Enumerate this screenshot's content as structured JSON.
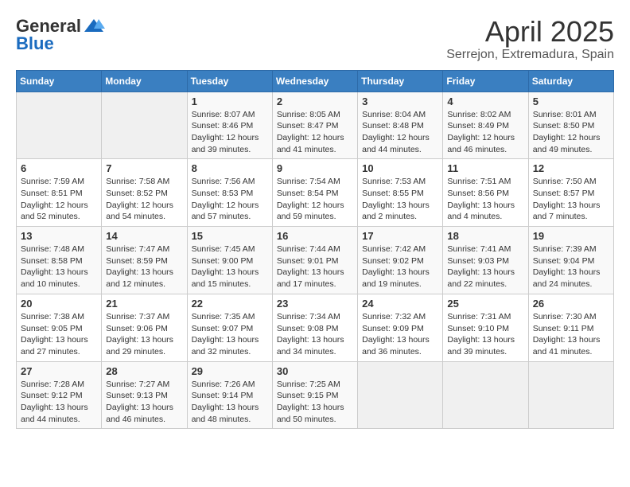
{
  "header": {
    "logo_general": "General",
    "logo_blue": "Blue",
    "title": "April 2025",
    "subtitle": "Serrejon, Extremadura, Spain"
  },
  "days_of_week": [
    "Sunday",
    "Monday",
    "Tuesday",
    "Wednesday",
    "Thursday",
    "Friday",
    "Saturday"
  ],
  "weeks": [
    [
      {
        "day": "",
        "sunrise": "",
        "sunset": "",
        "daylight": ""
      },
      {
        "day": "",
        "sunrise": "",
        "sunset": "",
        "daylight": ""
      },
      {
        "day": "1",
        "sunrise": "Sunrise: 8:07 AM",
        "sunset": "Sunset: 8:46 PM",
        "daylight": "Daylight: 12 hours and 39 minutes."
      },
      {
        "day": "2",
        "sunrise": "Sunrise: 8:05 AM",
        "sunset": "Sunset: 8:47 PM",
        "daylight": "Daylight: 12 hours and 41 minutes."
      },
      {
        "day": "3",
        "sunrise": "Sunrise: 8:04 AM",
        "sunset": "Sunset: 8:48 PM",
        "daylight": "Daylight: 12 hours and 44 minutes."
      },
      {
        "day": "4",
        "sunrise": "Sunrise: 8:02 AM",
        "sunset": "Sunset: 8:49 PM",
        "daylight": "Daylight: 12 hours and 46 minutes."
      },
      {
        "day": "5",
        "sunrise": "Sunrise: 8:01 AM",
        "sunset": "Sunset: 8:50 PM",
        "daylight": "Daylight: 12 hours and 49 minutes."
      }
    ],
    [
      {
        "day": "6",
        "sunrise": "Sunrise: 7:59 AM",
        "sunset": "Sunset: 8:51 PM",
        "daylight": "Daylight: 12 hours and 52 minutes."
      },
      {
        "day": "7",
        "sunrise": "Sunrise: 7:58 AM",
        "sunset": "Sunset: 8:52 PM",
        "daylight": "Daylight: 12 hours and 54 minutes."
      },
      {
        "day": "8",
        "sunrise": "Sunrise: 7:56 AM",
        "sunset": "Sunset: 8:53 PM",
        "daylight": "Daylight: 12 hours and 57 minutes."
      },
      {
        "day": "9",
        "sunrise": "Sunrise: 7:54 AM",
        "sunset": "Sunset: 8:54 PM",
        "daylight": "Daylight: 12 hours and 59 minutes."
      },
      {
        "day": "10",
        "sunrise": "Sunrise: 7:53 AM",
        "sunset": "Sunset: 8:55 PM",
        "daylight": "Daylight: 13 hours and 2 minutes."
      },
      {
        "day": "11",
        "sunrise": "Sunrise: 7:51 AM",
        "sunset": "Sunset: 8:56 PM",
        "daylight": "Daylight: 13 hours and 4 minutes."
      },
      {
        "day": "12",
        "sunrise": "Sunrise: 7:50 AM",
        "sunset": "Sunset: 8:57 PM",
        "daylight": "Daylight: 13 hours and 7 minutes."
      }
    ],
    [
      {
        "day": "13",
        "sunrise": "Sunrise: 7:48 AM",
        "sunset": "Sunset: 8:58 PM",
        "daylight": "Daylight: 13 hours and 10 minutes."
      },
      {
        "day": "14",
        "sunrise": "Sunrise: 7:47 AM",
        "sunset": "Sunset: 8:59 PM",
        "daylight": "Daylight: 13 hours and 12 minutes."
      },
      {
        "day": "15",
        "sunrise": "Sunrise: 7:45 AM",
        "sunset": "Sunset: 9:00 PM",
        "daylight": "Daylight: 13 hours and 15 minutes."
      },
      {
        "day": "16",
        "sunrise": "Sunrise: 7:44 AM",
        "sunset": "Sunset: 9:01 PM",
        "daylight": "Daylight: 13 hours and 17 minutes."
      },
      {
        "day": "17",
        "sunrise": "Sunrise: 7:42 AM",
        "sunset": "Sunset: 9:02 PM",
        "daylight": "Daylight: 13 hours and 19 minutes."
      },
      {
        "day": "18",
        "sunrise": "Sunrise: 7:41 AM",
        "sunset": "Sunset: 9:03 PM",
        "daylight": "Daylight: 13 hours and 22 minutes."
      },
      {
        "day": "19",
        "sunrise": "Sunrise: 7:39 AM",
        "sunset": "Sunset: 9:04 PM",
        "daylight": "Daylight: 13 hours and 24 minutes."
      }
    ],
    [
      {
        "day": "20",
        "sunrise": "Sunrise: 7:38 AM",
        "sunset": "Sunset: 9:05 PM",
        "daylight": "Daylight: 13 hours and 27 minutes."
      },
      {
        "day": "21",
        "sunrise": "Sunrise: 7:37 AM",
        "sunset": "Sunset: 9:06 PM",
        "daylight": "Daylight: 13 hours and 29 minutes."
      },
      {
        "day": "22",
        "sunrise": "Sunrise: 7:35 AM",
        "sunset": "Sunset: 9:07 PM",
        "daylight": "Daylight: 13 hours and 32 minutes."
      },
      {
        "day": "23",
        "sunrise": "Sunrise: 7:34 AM",
        "sunset": "Sunset: 9:08 PM",
        "daylight": "Daylight: 13 hours and 34 minutes."
      },
      {
        "day": "24",
        "sunrise": "Sunrise: 7:32 AM",
        "sunset": "Sunset: 9:09 PM",
        "daylight": "Daylight: 13 hours and 36 minutes."
      },
      {
        "day": "25",
        "sunrise": "Sunrise: 7:31 AM",
        "sunset": "Sunset: 9:10 PM",
        "daylight": "Daylight: 13 hours and 39 minutes."
      },
      {
        "day": "26",
        "sunrise": "Sunrise: 7:30 AM",
        "sunset": "Sunset: 9:11 PM",
        "daylight": "Daylight: 13 hours and 41 minutes."
      }
    ],
    [
      {
        "day": "27",
        "sunrise": "Sunrise: 7:28 AM",
        "sunset": "Sunset: 9:12 PM",
        "daylight": "Daylight: 13 hours and 44 minutes."
      },
      {
        "day": "28",
        "sunrise": "Sunrise: 7:27 AM",
        "sunset": "Sunset: 9:13 PM",
        "daylight": "Daylight: 13 hours and 46 minutes."
      },
      {
        "day": "29",
        "sunrise": "Sunrise: 7:26 AM",
        "sunset": "Sunset: 9:14 PM",
        "daylight": "Daylight: 13 hours and 48 minutes."
      },
      {
        "day": "30",
        "sunrise": "Sunrise: 7:25 AM",
        "sunset": "Sunset: 9:15 PM",
        "daylight": "Daylight: 13 hours and 50 minutes."
      },
      {
        "day": "",
        "sunrise": "",
        "sunset": "",
        "daylight": ""
      },
      {
        "day": "",
        "sunrise": "",
        "sunset": "",
        "daylight": ""
      },
      {
        "day": "",
        "sunrise": "",
        "sunset": "",
        "daylight": ""
      }
    ]
  ]
}
